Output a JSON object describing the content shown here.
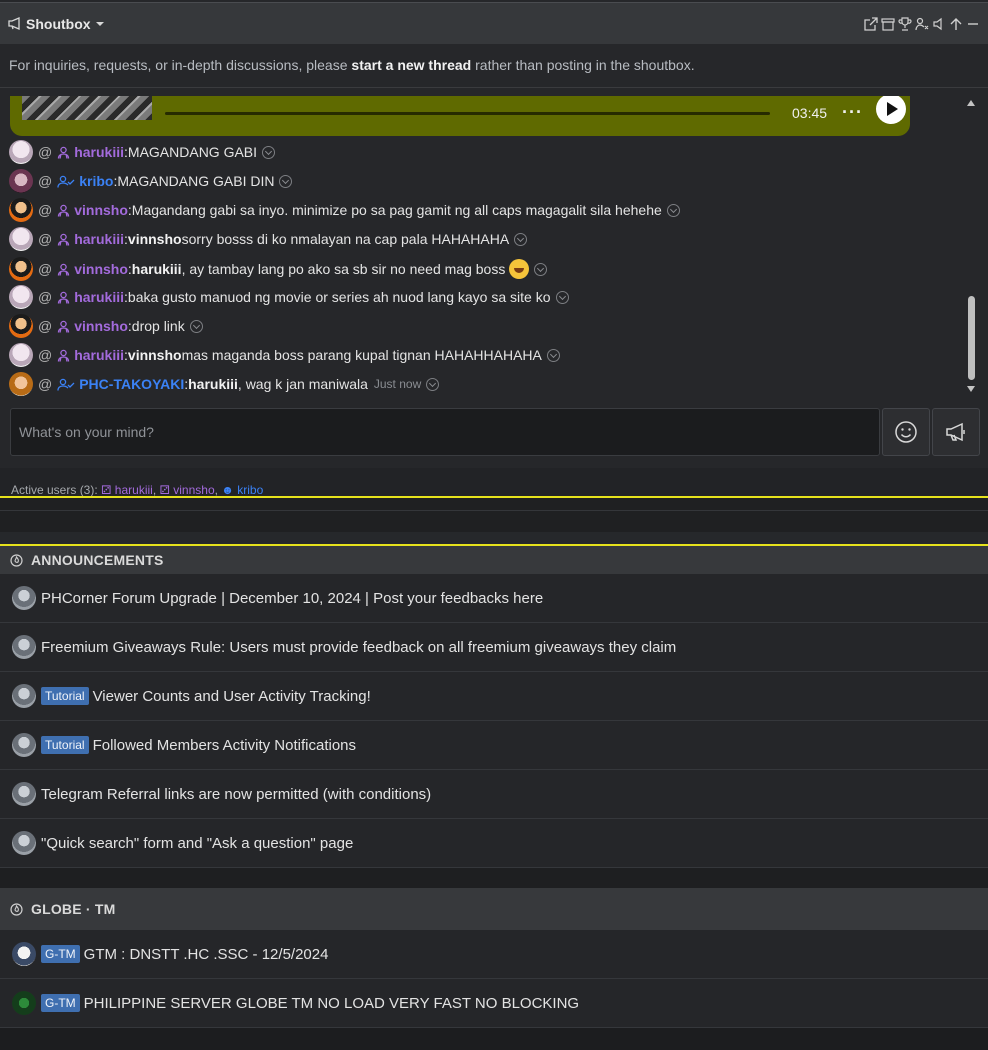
{
  "shoutbox": {
    "title": "Shoutbox",
    "notice_prefix": "For inquiries, requests, or in-depth discussions, please ",
    "notice_bold": "start a new thread",
    "notice_suffix": " rather than posting in the shoutbox.",
    "audio": {
      "time": "03:45",
      "more": "···"
    },
    "messages": [
      {
        "user": "harukiii",
        "sep": ": ",
        "mention": "",
        "text": "MAGANDANG GABI"
      },
      {
        "user": "kribo",
        "sep": ": ",
        "mention": "",
        "text": "MAGANDANG GABI DIN"
      },
      {
        "user": "vinnsho",
        "sep": ": ",
        "mention": "",
        "text": "Magandang gabi sa inyo. minimize po sa pag gamit ng all caps magagalit sila hehehe"
      },
      {
        "user": "harukiii",
        "sep": ": ",
        "mention": "vinnsho",
        "text": " sorry bosss di ko nmalayan na cap pala HAHAHAHA"
      },
      {
        "user": "vinnsho",
        "sep": ": ",
        "mention": "harukiii",
        "text": ", ay tambay lang po ako sa sb sir no need mag boss"
      },
      {
        "user": "harukiii",
        "sep": ": ",
        "mention": "",
        "text": "baka gusto manuod ng movie or series ah nuod lang kayo sa site ko"
      },
      {
        "user": "vinnsho",
        "sep": ": ",
        "mention": "",
        "text": "drop link"
      },
      {
        "user": "harukiii",
        "sep": ": ",
        "mention": "vinnsho",
        "text": " mas maganda boss parang kupal tignan HAHAHHAHAHA"
      },
      {
        "user": "PHC-TAKOYAKI",
        "sep": ": ",
        "mention": "harukiii",
        "text": ", wag k jan maniwala",
        "time": "Just now"
      }
    ],
    "at_symbol": "@",
    "input_placeholder": "What's on your mind?",
    "active_label": "Active users (3): ",
    "active_users": [
      "harukiii",
      "vinnsho",
      "kribo"
    ],
    "active_sep": ", "
  },
  "announcements": {
    "title": "ANNOUNCEMENTS",
    "threads": [
      {
        "tag": "",
        "title": "PHCorner Forum Upgrade | December 10, 2024 | Post your feedbacks here"
      },
      {
        "tag": "",
        "title": "Freemium Giveaways Rule: Users must provide feedback on all freemium giveaways they claim"
      },
      {
        "tag": "Tutorial",
        "title": "Viewer Counts and User Activity Tracking!"
      },
      {
        "tag": "Tutorial",
        "title": "Followed Members Activity Notifications"
      },
      {
        "tag": "",
        "title": "Telegram Referral links are now permitted (with conditions)"
      },
      {
        "tag": "",
        "title": "\"Quick search\" form and \"Ask a question\" page"
      }
    ]
  },
  "globe": {
    "title": "GLOBE · TM",
    "threads": [
      {
        "tag": "G-TM",
        "title": "GTM : DNSTT .HC .SSC - 12/5/2024"
      },
      {
        "tag": "G-TM",
        "title": "PHILIPPINE SERVER GLOBE TM NO LOAD VERY FAST NO BLOCKING"
      }
    ]
  },
  "colors": {
    "purple_user": "#a36bdc",
    "blue_user": "#3b82f6",
    "audio_bg": "#5f6a00",
    "tag_bg": "#3f6fb0",
    "highlight_line": "#e6e21c"
  }
}
